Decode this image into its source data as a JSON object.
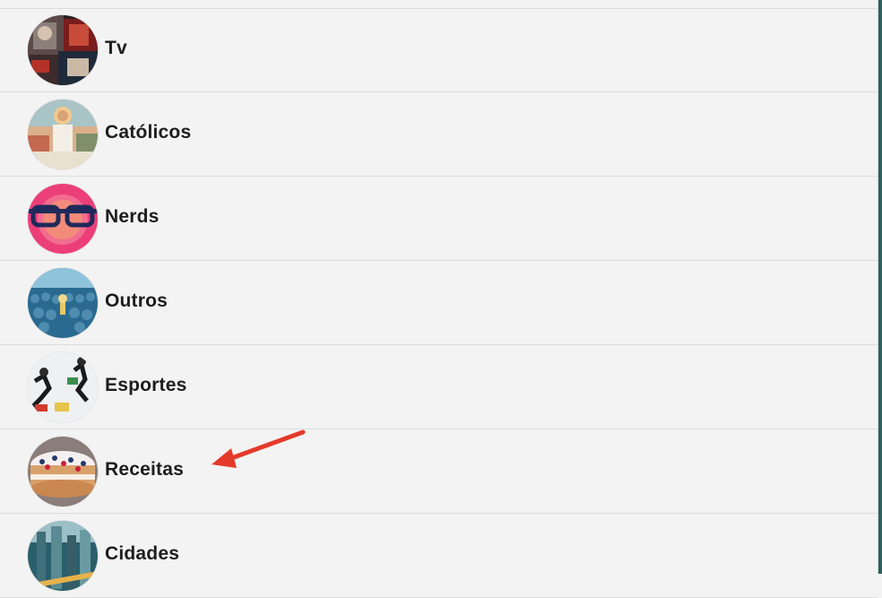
{
  "groups": [
    {
      "label": "Tv",
      "icon": "tv-avatar-icon"
    },
    {
      "label": "Católicos",
      "icon": "catholic-avatar-icon"
    },
    {
      "label": "Nerds",
      "icon": "nerd-glasses-avatar-icon"
    },
    {
      "label": "Outros",
      "icon": "crowd-avatar-icon"
    },
    {
      "label": "Esportes",
      "icon": "sports-avatar-icon"
    },
    {
      "label": "Receitas",
      "icon": "cake-avatar-icon"
    },
    {
      "label": "Cidades",
      "icon": "city-avatar-icon"
    }
  ],
  "colors": {
    "background": "#f3f3f3",
    "divider": "#dcdcdc",
    "text": "#1d1d1d",
    "annotation_arrow": "#e53a2a"
  }
}
